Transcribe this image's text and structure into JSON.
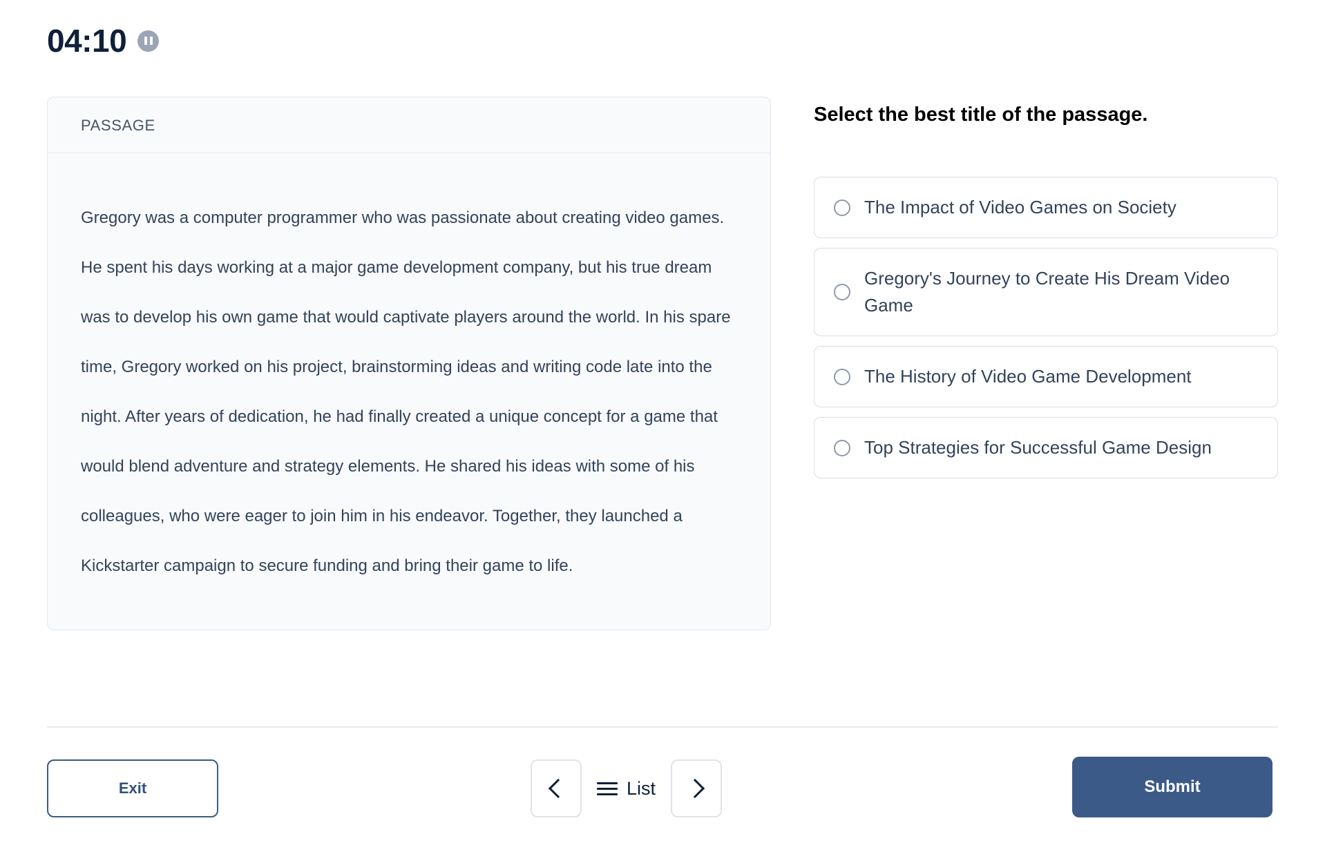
{
  "timer": {
    "value": "04:10",
    "pause_icon": "pause-icon"
  },
  "passage": {
    "header": "PASSAGE",
    "text": "Gregory was a computer programmer who was passionate about creating video games. He spent his days working at a major game development company, but his true dream was to develop his own game that would captivate players around the world. In his spare time, Gregory worked on his project, brainstorming ideas and writing code late into the night. After years of dedication, he had finally created a unique concept for a game that would blend adventure and strategy elements. He shared his ideas with some of his colleagues, who were eager to join him in his endeavor. Together, they launched a Kickstarter campaign to secure funding and bring their game to life."
  },
  "question": {
    "title": "Select the best title of the passage.",
    "options": [
      {
        "label": "The Impact of Video Games on Society",
        "selected": false
      },
      {
        "label": "Gregory's Journey to Create His Dream Video Game",
        "selected": false
      },
      {
        "label": "The History of Video Game Development",
        "selected": false
      },
      {
        "label": "Top Strategies for Successful Game Design",
        "selected": false
      }
    ]
  },
  "footer": {
    "exit_label": "Exit",
    "prev_icon": "chevron-left-icon",
    "list_label": "List",
    "list_icon": "hamburger-icon",
    "next_icon": "chevron-right-icon",
    "submit_label": "Submit"
  },
  "colors": {
    "accent": "#3c5a87",
    "timer_text": "#0f2038",
    "passage_bg": "#f8fafc",
    "body_text": "#33435a",
    "pause_circle": "#9aa5b5"
  }
}
